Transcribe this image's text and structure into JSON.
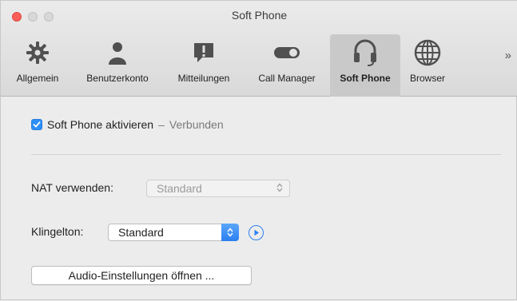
{
  "window": {
    "title": "Soft Phone"
  },
  "toolbar": {
    "items": [
      {
        "label": "Allgemein",
        "icon": "gear-icon",
        "selected": false
      },
      {
        "label": "Benutzerkonto",
        "icon": "user-icon",
        "selected": false
      },
      {
        "label": "Mitteilungen",
        "icon": "notification-icon",
        "selected": false
      },
      {
        "label": "Call Manager",
        "icon": "toggle-icon",
        "selected": false
      },
      {
        "label": "Soft Phone",
        "icon": "headset-icon",
        "selected": true
      },
      {
        "label": "Browser",
        "icon": "globe-icon",
        "selected": false
      }
    ],
    "overflow": "»"
  },
  "content": {
    "enable_label": "Soft Phone aktivieren",
    "enable_checked": true,
    "status_separator": "–",
    "status": "Verbunden",
    "nat_label": "NAT verwenden:",
    "nat_value": "Standard",
    "ringtone_label": "Klingelton:",
    "ringtone_value": "Standard",
    "audio_button": "Audio-Einstellungen öffnen ..."
  },
  "colors": {
    "accent": "#2d8ff5",
    "close": "#fc5f57"
  }
}
